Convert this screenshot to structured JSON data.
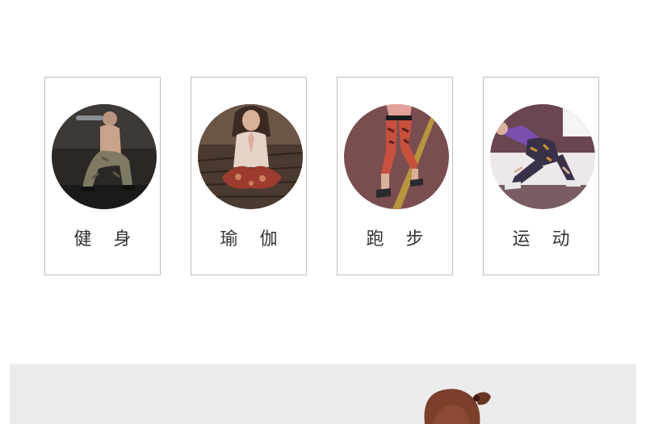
{
  "categories": [
    {
      "id": "fitness",
      "label": "健 身"
    },
    {
      "id": "yoga",
      "label": "瑜 伽"
    },
    {
      "id": "running",
      "label": "跑 步"
    },
    {
      "id": "sports",
      "label": "运 动"
    }
  ]
}
